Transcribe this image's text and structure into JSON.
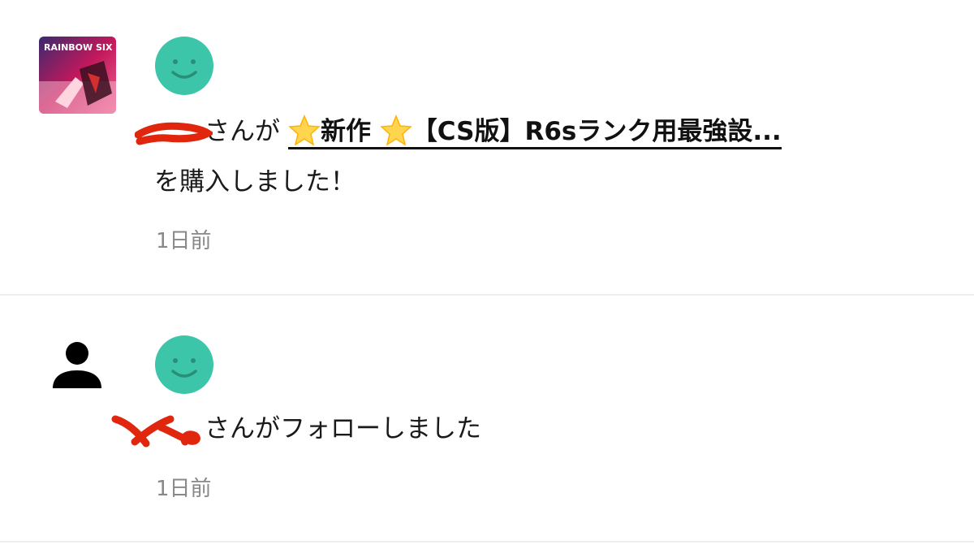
{
  "notifications": [
    {
      "type": "purchase",
      "thumbnail_text": "RAINBOW SIX",
      "suffix_1": "さんが",
      "product_title": "新作",
      "product_title_rest": "【CS版】R6sランク用最強設...",
      "line_2": "を購入しました！",
      "timestamp": "1日前"
    },
    {
      "type": "follow",
      "message": "さんがフォローしました",
      "timestamp": "1日前"
    }
  ],
  "colors": {
    "avatar_teal": "#3cc5a8",
    "scribble_red": "#e0260c",
    "timestamp_gray": "#888888",
    "divider": "#eeeeee"
  },
  "icons": {
    "avatar": "smiley-face-icon",
    "star": "glowing-star-icon",
    "person": "person-icon"
  }
}
